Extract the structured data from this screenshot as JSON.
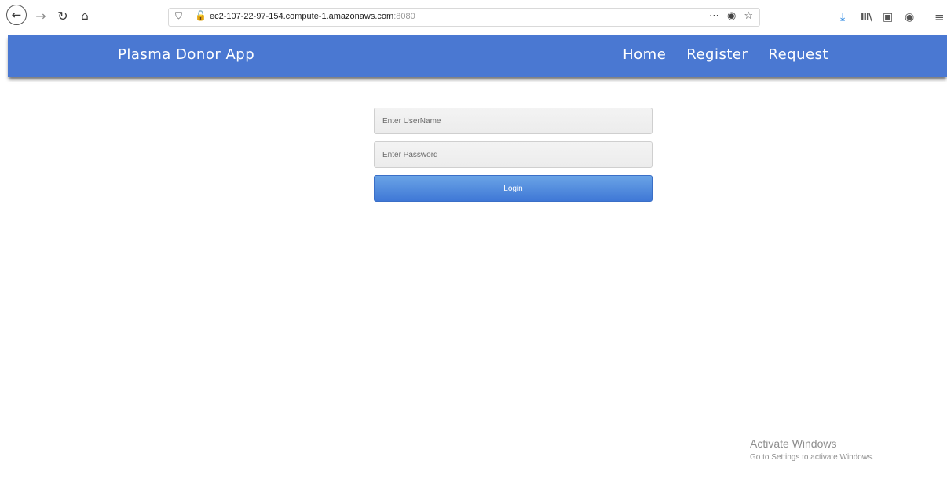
{
  "browser": {
    "url_host": "ec2-107-22-97-154.compute-1.amazonaws.com",
    "url_port": ":8080",
    "icons": {
      "back": "←",
      "forward": "→",
      "reload": "↻",
      "home": "⌂",
      "shield": "⛉",
      "insecure_lock": "🔓",
      "page_actions": "⋯",
      "pocket": "◉",
      "bookmark": "☆",
      "download": "⤓",
      "library": "III\\",
      "sidebar": "▣",
      "account": "◉",
      "menu": "≡"
    }
  },
  "navbar": {
    "brand": "Plasma Donor App",
    "links": [
      {
        "label": "Home"
      },
      {
        "label": "Register"
      },
      {
        "label": "Request"
      }
    ],
    "color": "#4a78d2"
  },
  "login": {
    "username_placeholder": "Enter UserName",
    "password_placeholder": "Enter Password",
    "button_label": "Login",
    "button_color": "#4a80d8"
  },
  "watermark": {
    "title": "Activate Windows",
    "subtitle": "Go to Settings to activate Windows."
  }
}
